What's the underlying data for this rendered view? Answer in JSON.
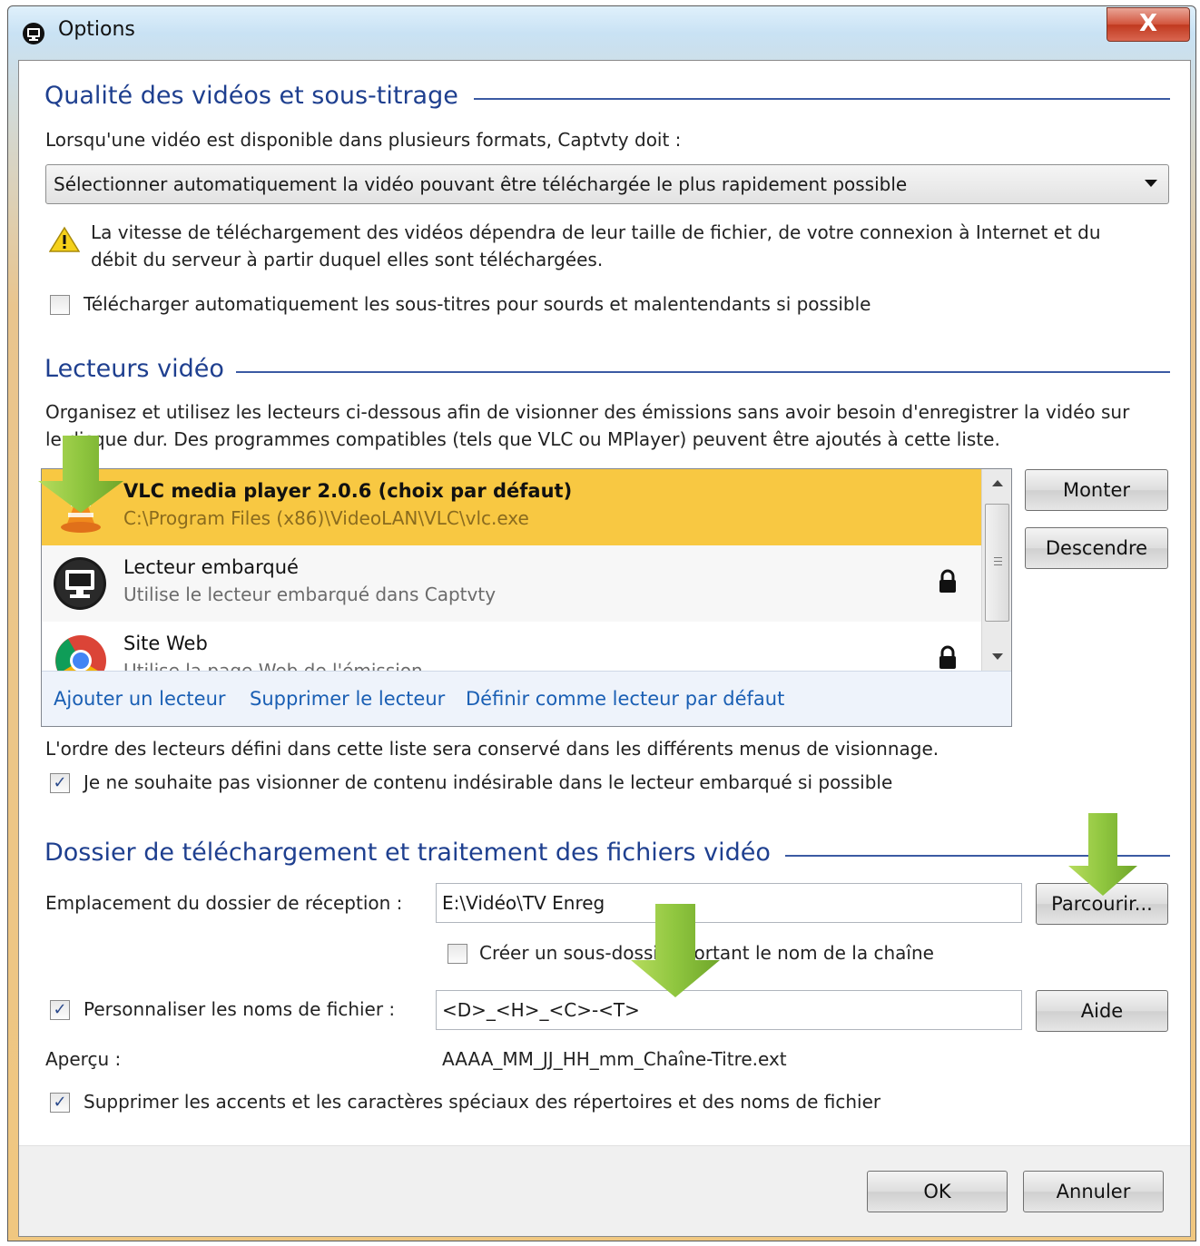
{
  "window": {
    "title": "Options",
    "close_label": "X"
  },
  "quality": {
    "heading": "Qualité des vidéos et sous-titrage",
    "intro": "Lorsqu'une vidéo est disponible dans plusieurs formats, Captvty doit :",
    "select_value": "Sélectionner automatiquement la vidéo pouvant être téléchargée le plus rapidement possible",
    "warning_line1": "La vitesse de téléchargement des vidéos dépendra de leur taille de fichier, de votre connexion à Internet et du",
    "warning_line2": "débit du serveur à partir duquel elles sont téléchargées.",
    "subtitles_label": "Télécharger automatiquement les sous-titres pour sourds et malentendants si possible",
    "subtitles_checked": false
  },
  "players": {
    "heading": "Lecteurs vidéo",
    "intro_line1": "Organisez et utilisez les lecteurs ci-dessous afin de visionner des émissions sans avoir besoin d'enregistrer la vidéo sur",
    "intro_line2": "le disque dur. Des programmes compatibles (tels que VLC ou MPlayer) peuvent être ajoutés à cette liste.",
    "items": [
      {
        "title": "VLC media player 2.0.6 (choix par défaut)",
        "subtitle": "C:\\Program Files (x86)\\VideoLAN\\VLC\\vlc.exe",
        "icon": "vlc-icon",
        "locked": false,
        "selected": true
      },
      {
        "title": "Lecteur embarqué",
        "subtitle": "Utilise le lecteur embarqué dans Captvty",
        "icon": "monitor-icon",
        "locked": true,
        "selected": false
      },
      {
        "title": "Site Web",
        "subtitle": "Utilise la page Web de l'émission",
        "icon": "chrome-icon",
        "locked": true,
        "selected": false
      }
    ],
    "actions": {
      "add": "Ajouter un lecteur",
      "remove": "Supprimer le lecteur",
      "set_default": "Définir comme lecteur par défaut"
    },
    "move_up": "Monter",
    "move_down": "Descendre",
    "order_note": "L'ordre des lecteurs défini dans cette liste sera conservé dans les différents menus de visionnage.",
    "no_unwanted_label": "Je ne souhaite pas visionner de contenu indésirable dans le lecteur embarqué si possible",
    "no_unwanted_checked": true
  },
  "download": {
    "heading": "Dossier de téléchargement et traitement des fichiers vidéo",
    "folder_label": "Emplacement du dossier de réception :",
    "folder_value": "E:\\Vidéo\\TV Enreg",
    "browse_label": "Parcourir...",
    "subfolder_label": "Créer un sous-dossier portant le nom de la chaîne",
    "subfolder_checked": false,
    "custom_names_label": "Personnaliser les noms de fichier :",
    "custom_names_checked": true,
    "pattern_value": "<D>_<H>_<C>-<T>",
    "help_label": "Aide",
    "preview_label": "Aperçu :",
    "preview_value": "AAAA_MM_JJ_HH_mm_Chaîne-Titre.ext",
    "strip_accents_label": "Supprimer les accents et les caractères spéciaux des répertoires et des noms de fichier",
    "strip_accents_checked": true
  },
  "footer": {
    "ok": "OK",
    "cancel": "Annuler"
  },
  "colors": {
    "heading": "#1e3f8f",
    "selection": "#f8c842",
    "link": "#1a5fb4",
    "annotation_arrow": "#8fc63f"
  }
}
